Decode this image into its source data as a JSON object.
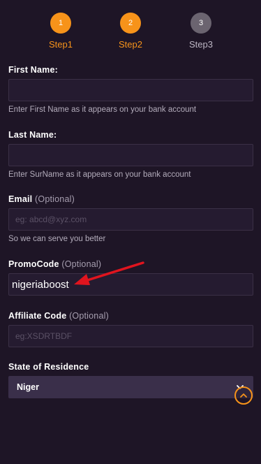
{
  "steps": [
    {
      "number": "1",
      "label": "Step1"
    },
    {
      "number": "2",
      "label": "Step2"
    },
    {
      "number": "3",
      "label": "Step3"
    }
  ],
  "first_name": {
    "label": "First Name:",
    "value": "",
    "hint": "Enter First Name as it appears on your bank account"
  },
  "last_name": {
    "label": "Last Name:",
    "value": "",
    "hint": "Enter SurName as it appears on your bank account"
  },
  "email": {
    "label": "Email",
    "optional": "(Optional)",
    "placeholder": "eg: abcd@xyz.com",
    "hint": "So we can serve you better"
  },
  "promo": {
    "label": "PromoCode",
    "optional": "(Optional)",
    "value": "nigeriaboost"
  },
  "affiliate": {
    "label": "Affiliate Code",
    "optional": "(Optional)",
    "placeholder": "eg:XSDRTBDF"
  },
  "state": {
    "label": "State of Residence",
    "value": "Niger"
  },
  "colors": {
    "accent": "#f7931a",
    "background": "#1e1526",
    "annotation": "#e0141e"
  }
}
